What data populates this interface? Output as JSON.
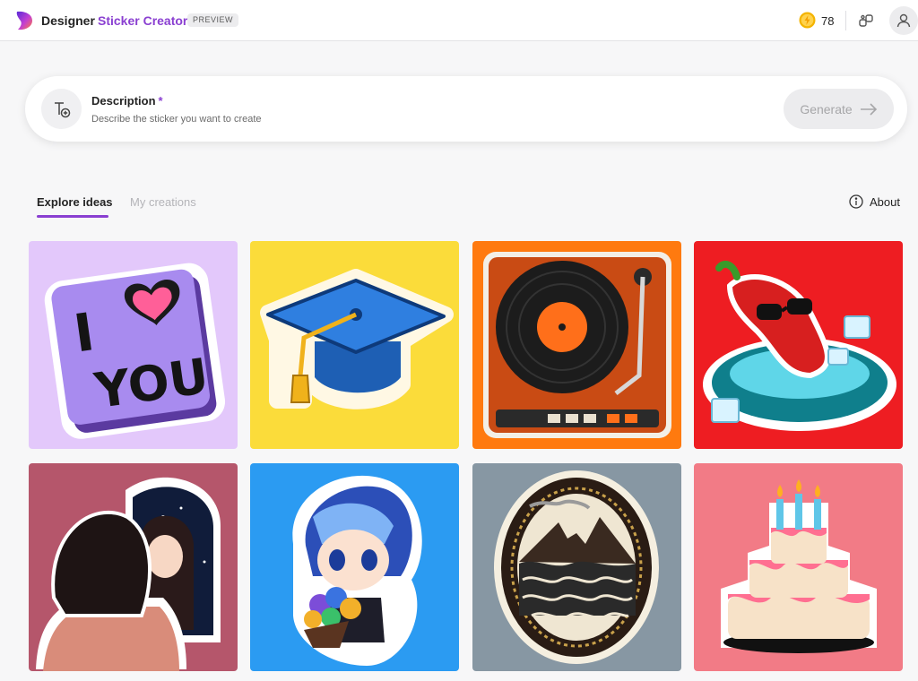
{
  "topbar": {
    "brand": "Designer",
    "product": "Sticker Creator",
    "badge": "PREVIEW",
    "coins": "78",
    "icons": {
      "logo": "designer-logo",
      "coin": "coin-icon",
      "share": "share-icon",
      "account": "account-icon"
    }
  },
  "description": {
    "label": "Description",
    "required_mark": "*",
    "placeholder": "Describe the sticker you want to create",
    "value": "",
    "generate_label": "Generate",
    "icons": {
      "field": "text-add-icon",
      "generate": "arrow-right-icon"
    }
  },
  "tabs": [
    {
      "label": "Explore ideas",
      "selected": true
    },
    {
      "label": "My creations",
      "selected": false
    }
  ],
  "about": {
    "label": "About",
    "icon": "info-icon"
  },
  "colors": {
    "accent": "#8a3fd1",
    "card_backgrounds": [
      "#e3c8fb",
      "#fbdc3a",
      "#ff7a0f",
      "#ee1d22",
      "#b5566b",
      "#2b9bf2",
      "#8797a3",
      "#f27b86"
    ]
  },
  "stickers": [
    {
      "subject": "i-love-you-sign",
      "lettering": [
        "I",
        "YOU"
      ]
    },
    {
      "subject": "graduation-cap"
    },
    {
      "subject": "record-turntable"
    },
    {
      "subject": "chili-pepper-in-pool"
    },
    {
      "subject": "girl-mirror-reflection"
    },
    {
      "subject": "anime-boy-with-bouquet"
    },
    {
      "subject": "mountain-waves-medallion"
    },
    {
      "subject": "birthday-cake"
    }
  ]
}
